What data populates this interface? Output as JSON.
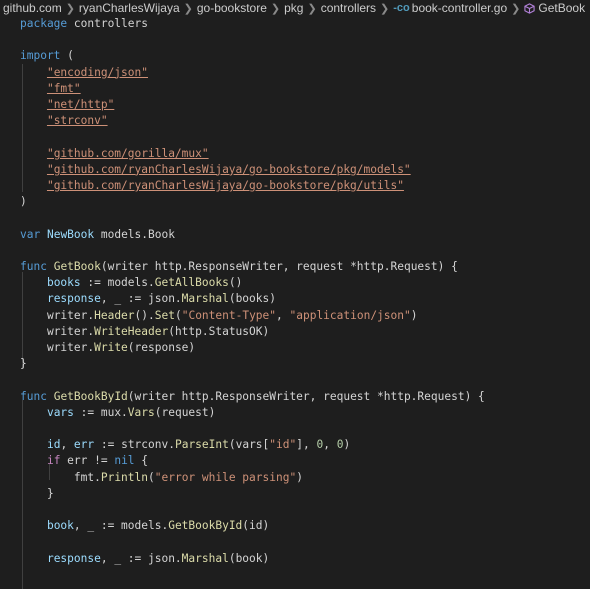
{
  "breadcrumb": {
    "items": [
      "github.com",
      "ryanCharlesWijaya",
      "go-bookstore",
      "pkg",
      "controllers"
    ],
    "file_label": "book-controller.go",
    "symbol_label": "GetBook"
  },
  "code": {
    "lines": [
      {
        "tokens": [
          {
            "t": "package",
            "c": "kw"
          },
          {
            "t": " controllers",
            "c": "typ"
          }
        ]
      },
      {
        "tokens": []
      },
      {
        "tokens": [
          {
            "t": "import",
            "c": "kw"
          },
          {
            "t": " (",
            "c": "op"
          }
        ]
      },
      {
        "tokens": [
          {
            "t": "    ",
            "c": "op"
          },
          {
            "t": "\"encoding/json\"",
            "c": "str"
          }
        ]
      },
      {
        "tokens": [
          {
            "t": "    ",
            "c": "op"
          },
          {
            "t": "\"fmt\"",
            "c": "str"
          }
        ]
      },
      {
        "tokens": [
          {
            "t": "    ",
            "c": "op"
          },
          {
            "t": "\"net/http\"",
            "c": "str"
          }
        ]
      },
      {
        "tokens": [
          {
            "t": "    ",
            "c": "op"
          },
          {
            "t": "\"strconv\"",
            "c": "str"
          }
        ]
      },
      {
        "tokens": []
      },
      {
        "tokens": [
          {
            "t": "    ",
            "c": "op"
          },
          {
            "t": "\"github.com/gorilla/mux\"",
            "c": "str"
          }
        ]
      },
      {
        "tokens": [
          {
            "t": "    ",
            "c": "op"
          },
          {
            "t": "\"github.com/ryanCharlesWijaya/go-bookstore/pkg/models\"",
            "c": "str"
          }
        ]
      },
      {
        "tokens": [
          {
            "t": "    ",
            "c": "op"
          },
          {
            "t": "\"github.com/ryanCharlesWijaya/go-bookstore/pkg/utils\"",
            "c": "str"
          }
        ]
      },
      {
        "tokens": [
          {
            "t": ")",
            "c": "op"
          }
        ]
      },
      {
        "tokens": []
      },
      {
        "tokens": [
          {
            "t": "var",
            "c": "kw"
          },
          {
            "t": " ",
            "c": "op"
          },
          {
            "t": "NewBook",
            "c": "var"
          },
          {
            "t": " models.Book",
            "c": "typ"
          }
        ]
      },
      {
        "tokens": []
      },
      {
        "tokens": [
          {
            "t": "func",
            "c": "kw"
          },
          {
            "t": " ",
            "c": "op"
          },
          {
            "t": "GetBook",
            "c": "fn"
          },
          {
            "t": "(writer http.ResponseWriter, request *http.Request) {",
            "c": "typ"
          }
        ]
      },
      {
        "tokens": [
          {
            "t": "    ",
            "c": "op"
          },
          {
            "t": "books",
            "c": "var"
          },
          {
            "t": " := models.",
            "c": "op"
          },
          {
            "t": "GetAllBooks",
            "c": "fn"
          },
          {
            "t": "()",
            "c": "op"
          }
        ]
      },
      {
        "tokens": [
          {
            "t": "    ",
            "c": "op"
          },
          {
            "t": "response",
            "c": "var"
          },
          {
            "t": ", _ := json.",
            "c": "op"
          },
          {
            "t": "Marshal",
            "c": "fn"
          },
          {
            "t": "(books)",
            "c": "op"
          }
        ]
      },
      {
        "tokens": [
          {
            "t": "    ",
            "c": "op"
          },
          {
            "t": "writer.",
            "c": "op"
          },
          {
            "t": "Header",
            "c": "fn"
          },
          {
            "t": "().",
            "c": "op"
          },
          {
            "t": "Set",
            "c": "fn"
          },
          {
            "t": "(",
            "c": "op"
          },
          {
            "t": "\"Content-Type\"",
            "c": "strp"
          },
          {
            "t": ", ",
            "c": "op"
          },
          {
            "t": "\"application/json\"",
            "c": "strp"
          },
          {
            "t": ")",
            "c": "op"
          }
        ]
      },
      {
        "tokens": [
          {
            "t": "    ",
            "c": "op"
          },
          {
            "t": "writer.",
            "c": "op"
          },
          {
            "t": "WriteHeader",
            "c": "fn"
          },
          {
            "t": "(http.StatusOK)",
            "c": "op"
          }
        ]
      },
      {
        "tokens": [
          {
            "t": "    ",
            "c": "op"
          },
          {
            "t": "writer.",
            "c": "op"
          },
          {
            "t": "Write",
            "c": "fn"
          },
          {
            "t": "(response)",
            "c": "op"
          }
        ]
      },
      {
        "tokens": [
          {
            "t": "}",
            "c": "op"
          }
        ]
      },
      {
        "tokens": []
      },
      {
        "tokens": [
          {
            "t": "func",
            "c": "kw"
          },
          {
            "t": " ",
            "c": "op"
          },
          {
            "t": "GetBookById",
            "c": "fn"
          },
          {
            "t": "(writer http.ResponseWriter, request *http.Request) {",
            "c": "typ"
          }
        ]
      },
      {
        "tokens": [
          {
            "t": "    ",
            "c": "op"
          },
          {
            "t": "vars",
            "c": "var"
          },
          {
            "t": " := mux.",
            "c": "op"
          },
          {
            "t": "Vars",
            "c": "fn"
          },
          {
            "t": "(request)",
            "c": "op"
          }
        ]
      },
      {
        "tokens": []
      },
      {
        "tokens": [
          {
            "t": "    ",
            "c": "op"
          },
          {
            "t": "id",
            "c": "var"
          },
          {
            "t": ", ",
            "c": "op"
          },
          {
            "t": "err",
            "c": "var"
          },
          {
            "t": " := strconv.",
            "c": "op"
          },
          {
            "t": "ParseInt",
            "c": "fn"
          },
          {
            "t": "(vars[",
            "c": "op"
          },
          {
            "t": "\"id\"",
            "c": "strp"
          },
          {
            "t": "], ",
            "c": "op"
          },
          {
            "t": "0",
            "c": "num"
          },
          {
            "t": ", ",
            "c": "op"
          },
          {
            "t": "0",
            "c": "num"
          },
          {
            "t": ")",
            "c": "op"
          }
        ]
      },
      {
        "tokens": [
          {
            "t": "    ",
            "c": "op"
          },
          {
            "t": "if",
            "c": "ctl"
          },
          {
            "t": " err != ",
            "c": "op"
          },
          {
            "t": "nil",
            "c": "kw"
          },
          {
            "t": " {",
            "c": "op"
          }
        ]
      },
      {
        "tokens": [
          {
            "t": "        ",
            "c": "op"
          },
          {
            "t": "fmt.",
            "c": "op"
          },
          {
            "t": "Println",
            "c": "fn"
          },
          {
            "t": "(",
            "c": "op"
          },
          {
            "t": "\"error while parsing\"",
            "c": "strp"
          },
          {
            "t": ")",
            "c": "op"
          }
        ]
      },
      {
        "tokens": [
          {
            "t": "    ",
            "c": "op"
          },
          {
            "t": "}",
            "c": "op"
          }
        ]
      },
      {
        "tokens": []
      },
      {
        "tokens": [
          {
            "t": "    ",
            "c": "op"
          },
          {
            "t": "book",
            "c": "var"
          },
          {
            "t": ", _ := models.",
            "c": "op"
          },
          {
            "t": "GetBookById",
            "c": "fn"
          },
          {
            "t": "(id)",
            "c": "op"
          }
        ]
      },
      {
        "tokens": []
      },
      {
        "tokens": [
          {
            "t": "    ",
            "c": "op"
          },
          {
            "t": "response",
            "c": "var"
          },
          {
            "t": ", _ := json.",
            "c": "op"
          },
          {
            "t": "Marshal",
            "c": "fn"
          },
          {
            "t": "(book)",
            "c": "op"
          }
        ]
      }
    ]
  }
}
